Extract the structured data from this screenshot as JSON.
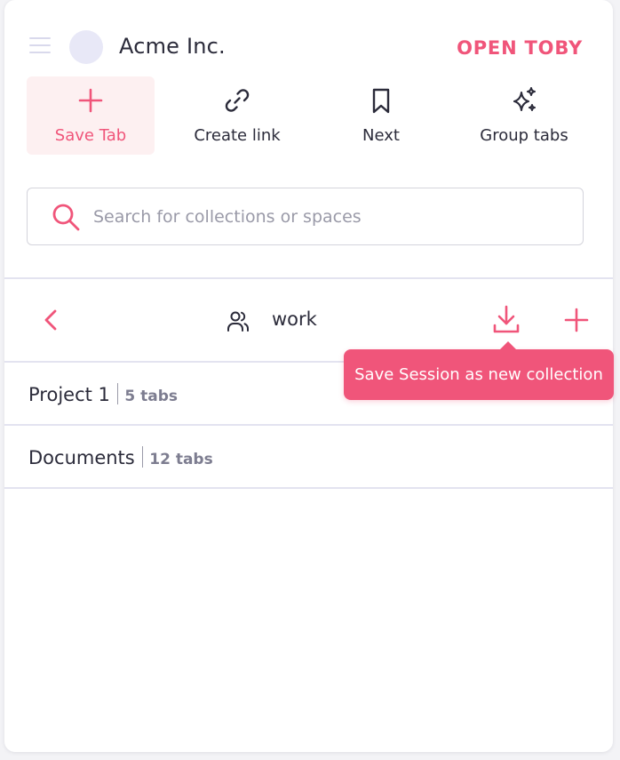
{
  "header": {
    "org_name": "Acme Inc.",
    "open_toby_label": "OPEN TOBY"
  },
  "toolbar": {
    "items": [
      {
        "label": "Save Tab",
        "icon": "plus-icon",
        "active": true
      },
      {
        "label": "Create link",
        "icon": "link-icon",
        "active": false
      },
      {
        "label": "Next",
        "icon": "bookmark-icon",
        "active": false
      },
      {
        "label": "Group tabs",
        "icon": "sparkles-icon",
        "active": false
      }
    ]
  },
  "search": {
    "placeholder": "Search for collections or spaces",
    "value": ""
  },
  "space": {
    "name": "work",
    "tooltip": "Save Session as new collection"
  },
  "collections": [
    {
      "name": "Project 1",
      "count": "5 tabs"
    },
    {
      "name": "Documents",
      "count": "12 tabs"
    }
  ],
  "colors": {
    "accent": "#f0557a",
    "active_bg": "#fdf0f1",
    "text": "#2b2b3a",
    "muted": "#7d7d90",
    "divider": "#e3e3f0"
  }
}
